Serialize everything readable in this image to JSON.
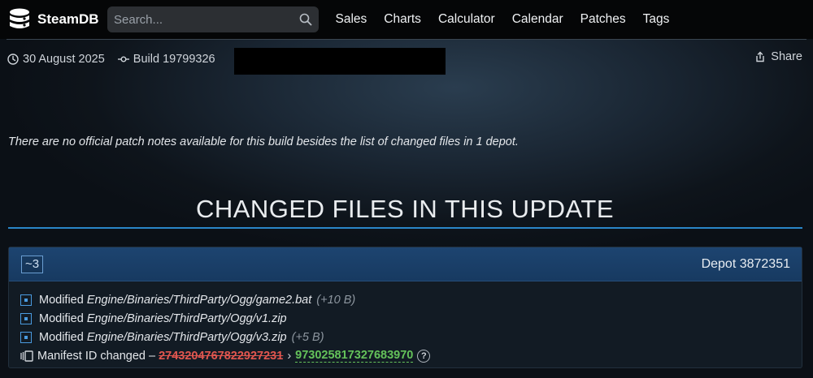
{
  "header": {
    "logo_text": "SteamDB",
    "search_placeholder": "Search...",
    "nav": [
      "Sales",
      "Charts",
      "Calculator",
      "Calendar",
      "Patches",
      "Tags"
    ]
  },
  "meta": {
    "date": "30 August 2025",
    "build": "Build 19799326",
    "share_label": "Share"
  },
  "notice": "There are no official patch notes available for this build besides the list of changed files in 1 depot.",
  "section_title": "CHANGED FILES IN THIS UPDATE",
  "depot": {
    "change_count": "~3",
    "label": "Depot 3872351",
    "files": [
      {
        "action": "Modified",
        "path": "Engine/Binaries/ThirdParty/Ogg/game2.bat",
        "size": "(+10 B)"
      },
      {
        "action": "Modified",
        "path": "Engine/Binaries/ThirdParty/Ogg/v1.zip",
        "size": ""
      },
      {
        "action": "Modified",
        "path": "Engine/Binaries/ThirdParty/Ogg/v3.zip",
        "size": "(+5 B)"
      }
    ],
    "manifest": {
      "label": "Manifest ID changed –",
      "old_id": "2743204767822927231",
      "arrow": "›",
      "new_id": "973025817327683970",
      "help": "?"
    }
  },
  "colors": {
    "accent_blue": "#2a86c8",
    "old_id": "#e0564f",
    "new_id": "#64c25a"
  }
}
